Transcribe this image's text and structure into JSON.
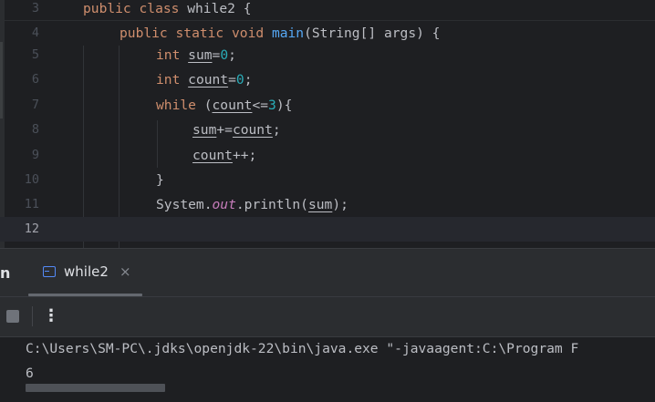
{
  "editor": {
    "lines": [
      {
        "num": "3",
        "tokens": [
          {
            "t": "public class ",
            "c": "kw"
          },
          {
            "t": "while2 {",
            "c": ""
          }
        ]
      },
      {
        "num": "4",
        "tokens": [
          {
            "t": "public static void ",
            "c": "kw"
          },
          {
            "t": "main",
            "c": "fn"
          },
          {
            "t": "(String[] args) {",
            "c": ""
          }
        ]
      },
      {
        "num": "5",
        "tokens": [
          {
            "t": "int ",
            "c": "kw"
          },
          {
            "t": "sum",
            "c": "ul"
          },
          {
            "t": "=",
            "c": ""
          },
          {
            "t": "0",
            "c": "num"
          },
          {
            "t": ";",
            "c": ""
          }
        ]
      },
      {
        "num": "6",
        "tokens": [
          {
            "t": "int ",
            "c": "kw"
          },
          {
            "t": "count",
            "c": "ul"
          },
          {
            "t": "=",
            "c": ""
          },
          {
            "t": "0",
            "c": "num"
          },
          {
            "t": ";",
            "c": ""
          }
        ]
      },
      {
        "num": "7",
        "tokens": [
          {
            "t": "while ",
            "c": "kw"
          },
          {
            "t": "(",
            "c": ""
          },
          {
            "t": "count",
            "c": "ul"
          },
          {
            "t": "<=",
            "c": ""
          },
          {
            "t": "3",
            "c": "num"
          },
          {
            "t": "){",
            "c": ""
          }
        ]
      },
      {
        "num": "8",
        "tokens": [
          {
            "t": "sum",
            "c": "ul"
          },
          {
            "t": "+=",
            "c": ""
          },
          {
            "t": "count",
            "c": "ul"
          },
          {
            "t": ";",
            "c": ""
          }
        ]
      },
      {
        "num": "9",
        "tokens": [
          {
            "t": "count",
            "c": "ul"
          },
          {
            "t": "++;",
            "c": ""
          }
        ]
      },
      {
        "num": "10",
        "tokens": [
          {
            "t": "}",
            "c": ""
          }
        ]
      },
      {
        "num": "11",
        "tokens": [
          {
            "t": "System.",
            "c": ""
          },
          {
            "t": "out",
            "c": "st"
          },
          {
            "t": ".println(",
            "c": ""
          },
          {
            "t": "sum",
            "c": "ul"
          },
          {
            "t": ");",
            "c": ""
          }
        ]
      },
      {
        "num": "12",
        "tokens": []
      }
    ]
  },
  "run_panel": {
    "tool_letter": "n",
    "tab_label": "while2",
    "tab_close": "×",
    "more_label": "⋮"
  },
  "console": {
    "command": "C:\\Users\\SM-PC\\.jdks\\openjdk-22\\bin\\java.exe \"-javaagent:C:\\Program F",
    "output": "6"
  }
}
